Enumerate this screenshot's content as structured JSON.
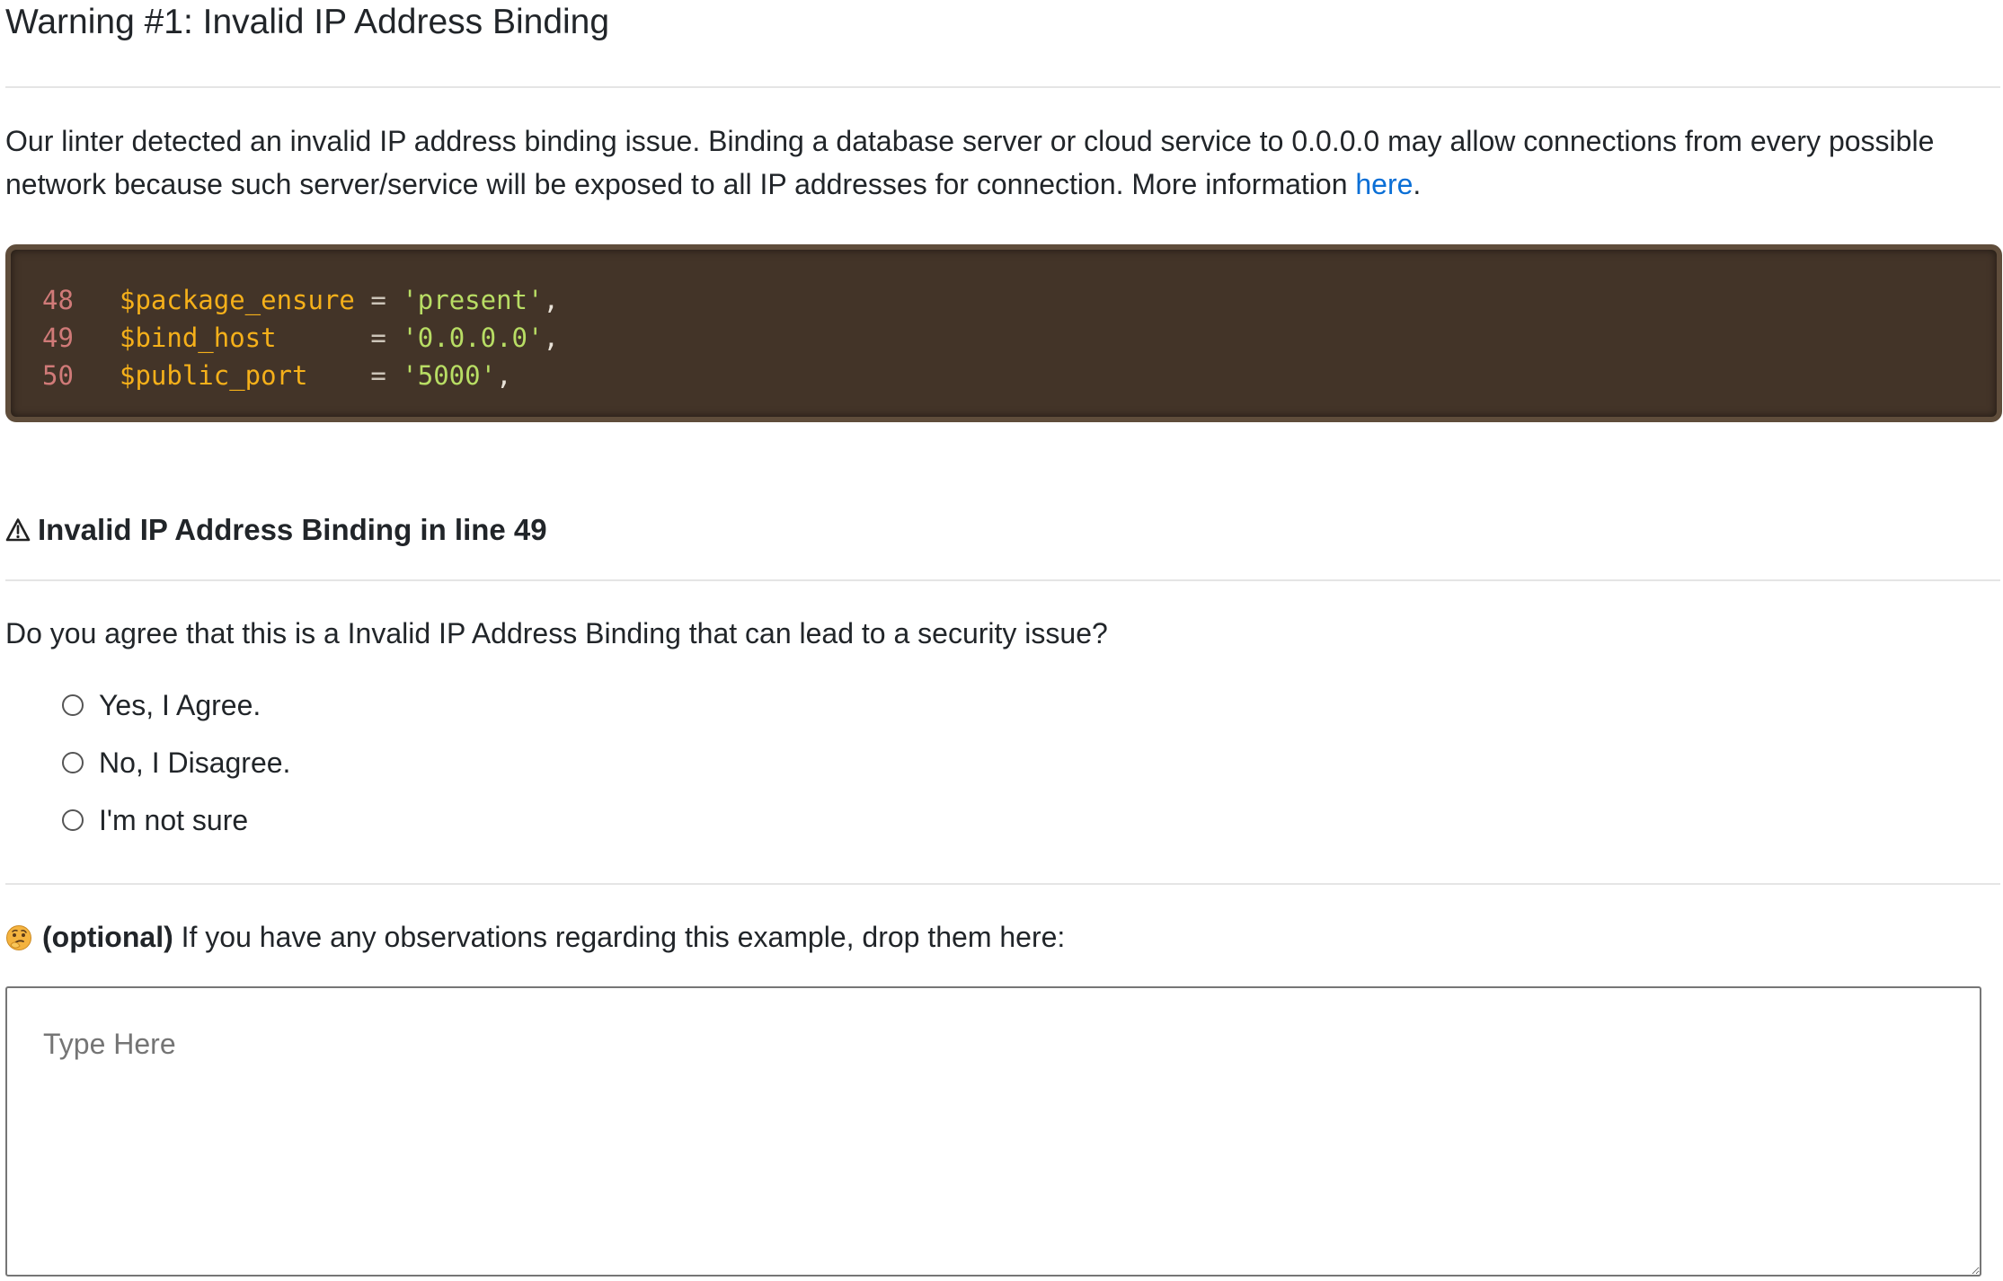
{
  "warning": {
    "title": "Warning #1: Invalid IP Address Binding",
    "intro_text": "Our linter detected an invalid IP address binding issue. Binding a database server or cloud service to 0.0.0.0 may allow connections from every possible network because such server/service will be exposed to all IP addresses for connection. More information ",
    "link_text": "here",
    "intro_suffix": "."
  },
  "code": {
    "lines": [
      {
        "number": "48",
        "variable": "$package_ensure",
        "padding": " ",
        "operator": "=",
        "value": "'present'",
        "suffix": ","
      },
      {
        "number": "49",
        "variable": "$bind_host",
        "padding": "      ",
        "operator": "=",
        "value": "'0.0.0.0'",
        "suffix": ","
      },
      {
        "number": "50",
        "variable": "$public_port",
        "padding": "    ",
        "operator": "=",
        "value": "'5000'",
        "suffix": ","
      }
    ]
  },
  "issue": {
    "icon": "warning-icon",
    "heading": "Invalid IP Address Binding in line 49",
    "question": "Do you agree that this is a Invalid IP Address Binding that can lead to a security issue?",
    "options": [
      "Yes, I Agree.",
      "No, I Disagree.",
      "I'm not sure"
    ]
  },
  "feedback": {
    "icon": "thinking-face-icon",
    "optional_label": "(optional)",
    "prompt": " If you have any observations regarding this example, drop them here:",
    "placeholder": "Type Here",
    "value": ""
  },
  "colors": {
    "link": "#0a6fd6",
    "code_background": "#433428",
    "code_border": "#5f4d3b",
    "line_number": "#d07a78",
    "variable": "#f5b01a",
    "string": "#b8dd64"
  }
}
